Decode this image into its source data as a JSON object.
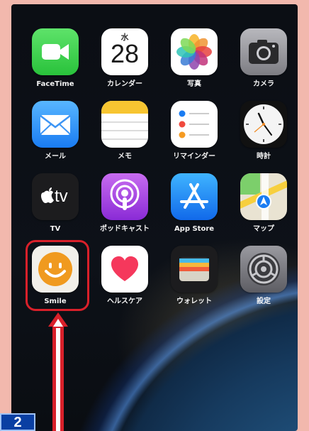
{
  "apps": [
    {
      "label": "FaceTime",
      "icon": "facetime-icon"
    },
    {
      "label": "カレンダー",
      "icon": "calendar-icon",
      "weekday": "水",
      "day": "28"
    },
    {
      "label": "写真",
      "icon": "photos-icon"
    },
    {
      "label": "カメラ",
      "icon": "camera-icon"
    },
    {
      "label": "メール",
      "icon": "mail-icon"
    },
    {
      "label": "メモ",
      "icon": "notes-icon"
    },
    {
      "label": "リマインダー",
      "icon": "reminders-icon"
    },
    {
      "label": "時計",
      "icon": "clock-icon"
    },
    {
      "label": "TV",
      "icon": "apple-tv-icon",
      "glyph": "tv"
    },
    {
      "label": "ポッドキャスト",
      "icon": "podcasts-icon"
    },
    {
      "label": "App Store",
      "icon": "app-store-icon"
    },
    {
      "label": "マップ",
      "icon": "maps-icon"
    },
    {
      "label": "Smile",
      "icon": "smile-icon"
    },
    {
      "label": "ヘルスケア",
      "icon": "health-icon"
    },
    {
      "label": "ウォレット",
      "icon": "wallet-icon"
    },
    {
      "label": "設定",
      "icon": "settings-icon"
    }
  ],
  "step_badge": "2",
  "highlight_color": "#d9202a",
  "badge_color": "#0a3fa3"
}
